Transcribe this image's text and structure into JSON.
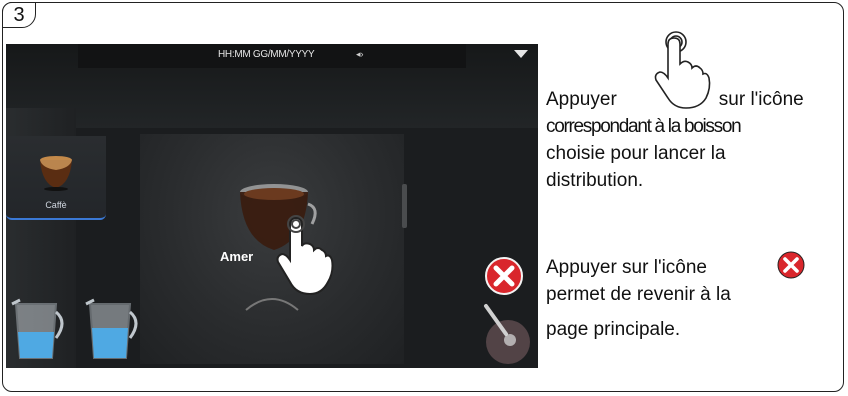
{
  "step": {
    "number": "3"
  },
  "screen": {
    "status_time": "HH:MM GG/MM/YYYY",
    "status_volume_icon": "speaker-icon",
    "menu_icon": "chevron-down-icon",
    "side_tile_label": "Caffè",
    "selected_drink_label": "Amer",
    "close_button_icon": "close-x-icon",
    "accent_color": "#3b79d6",
    "close_color": "#d9262c"
  },
  "instructions": {
    "p1_a": "Appuyer",
    "p1_b": "sur l'icône",
    "p1_line2": "correspondant à la boisson",
    "p1_line3": "choisie pour lancer la",
    "p1_line4": "distribution.",
    "p2_a": "Appuyer sur l'icône",
    "p2_line2": "permet de revenir à la",
    "p2_line3": "page principale."
  }
}
